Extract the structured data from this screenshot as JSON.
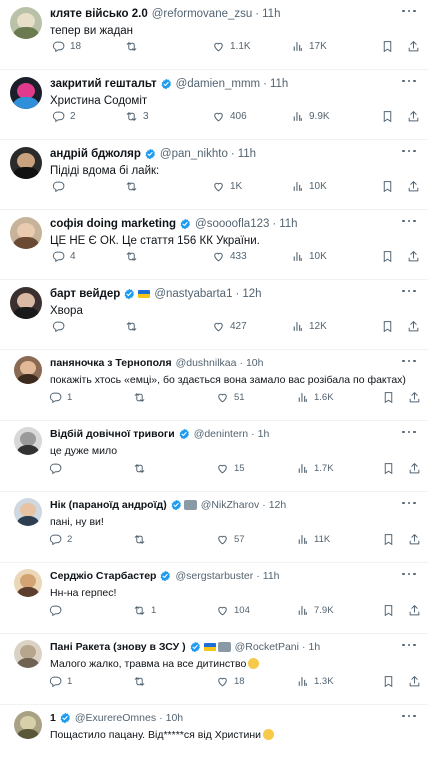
{
  "tweets": [
    {
      "name": "кляте військо 2.0",
      "verified": false,
      "badges": [],
      "handle": "@reformovane_zsu",
      "time": "11h",
      "text": "тепер ви жадан",
      "replies": "18",
      "reposts": "",
      "likes": "1.1K",
      "views": "17K",
      "avatar": {
        "bg": "#b9c2a8",
        "face": "#e8dfc8",
        "body": "#6b7a4f"
      }
    },
    {
      "name": "закритий гештальт",
      "verified": true,
      "badges": [],
      "handle": "@damien_mmm",
      "time": "11h",
      "text": "Христина Содоміт",
      "replies": "2",
      "reposts": "3",
      "likes": "406",
      "views": "9.9K",
      "avatar": {
        "bg": "#1b1f2a",
        "face": "#e03a8c",
        "body": "#2f8fd9"
      }
    },
    {
      "name": "андрій бджоляр",
      "verified": true,
      "badges": [],
      "handle": "@pan_nikhto",
      "time": "11h",
      "text": "Підіді вдома бі лайк:",
      "replies": "",
      "reposts": "",
      "likes": "1K",
      "views": "10K",
      "avatar": {
        "bg": "#2b2b2b",
        "face": "#c9a27e",
        "body": "#111111"
      }
    },
    {
      "name": "софія doing marketing",
      "verified": true,
      "badges": [],
      "handle": "@sooooflа123",
      "time": "11h",
      "text": "ЦЕ НЕ Є ОК. Це стаття 156 КК України.",
      "replies": "4",
      "reposts": "",
      "likes": "433",
      "views": "10K",
      "avatar": {
        "bg": "#c7b29a",
        "face": "#e9cbb0",
        "body": "#6b4a33"
      }
    },
    {
      "name": "барт вейдер",
      "verified": true,
      "badges": [
        "flag"
      ],
      "handle": "@nastyabarta1",
      "time": "12h",
      "text": "Хвора",
      "replies": "",
      "reposts": "",
      "likes": "427",
      "views": "12K",
      "avatar": {
        "bg": "#3a3030",
        "face": "#d9b9a3",
        "body": "#1a1a1a"
      }
    },
    {
      "name": "паняночка з Тернополя",
      "verified": false,
      "badges": [],
      "handle": "@dushnilkaa",
      "time": "10h",
      "text": "покажіть хтось «емці», бо здається вона замало вас розібала по фактах)",
      "replies": "1",
      "reposts": "",
      "likes": "51",
      "views": "1.6K",
      "avatar": {
        "bg": "#8a6a52",
        "face": "#e2b996",
        "body": "#3d2a1e"
      }
    },
    {
      "name": "Відбій довічної тривоги",
      "verified": true,
      "badges": [],
      "handle": "@denintern",
      "time": "1h",
      "text": "це дуже мило",
      "replies": "",
      "reposts": "",
      "likes": "15",
      "views": "1.7K",
      "avatar": {
        "bg": "#d8d8d8",
        "face": "#9a9a9a",
        "body": "#333333"
      }
    },
    {
      "name": "Нік (параноїд андроїд)",
      "verified": true,
      "badges": [
        "emoji"
      ],
      "handle": "@NikZharov",
      "time": "12h",
      "text": "пані, ну ви!",
      "replies": "2",
      "reposts": "",
      "likes": "57",
      "views": "11K",
      "avatar": {
        "bg": "#cfd8e0",
        "face": "#e7c3a4",
        "body": "#2c3e50"
      }
    },
    {
      "name": "Серджіо Старбастер",
      "verified": true,
      "badges": [],
      "handle": "@sergstarbuster",
      "time": "11h",
      "text": "Нн-на герпес!",
      "replies": "",
      "reposts": "1",
      "likes": "104",
      "views": "7.9K",
      "avatar": {
        "bg": "#e9d7b8",
        "face": "#d4a373",
        "body": "#5c3d2e"
      }
    },
    {
      "name": "Пані Ракета (знову в ЗСУ )",
      "verified": true,
      "badges": [
        "flag",
        "emoji"
      ],
      "handle": "@RocketPani",
      "time": "1h",
      "text": "Малого жалко, травма на все дитинство",
      "replies": "1",
      "reposts": "",
      "likes": "18",
      "views": "1.3K",
      "avatar": {
        "bg": "#d9d2c5",
        "face": "#b8a58e",
        "body": "#6f6253"
      }
    },
    {
      "name": "1",
      "verified": true,
      "badges": [],
      "handle": "@ExurereOmnes",
      "time": "10h",
      "text": "Пощастило пацану. Від*****ся від Христини",
      "replies": "",
      "reposts": "",
      "likes": "",
      "views": "",
      "avatar": {
        "bg": "#a9a184",
        "face": "#d6cfa8",
        "body": "#5a5638"
      }
    }
  ],
  "colors": {
    "accent": "#1d9bf0",
    "muted": "#536471",
    "text": "#0f1419",
    "divider": "#eff3f4"
  },
  "icons": {
    "reply": "reply-icon",
    "repost": "repost-icon",
    "like": "heart-icon",
    "views": "views-icon",
    "bookmark": "bookmark-icon",
    "share": "share-icon",
    "more": "more-icon",
    "verified": "verified-icon"
  }
}
